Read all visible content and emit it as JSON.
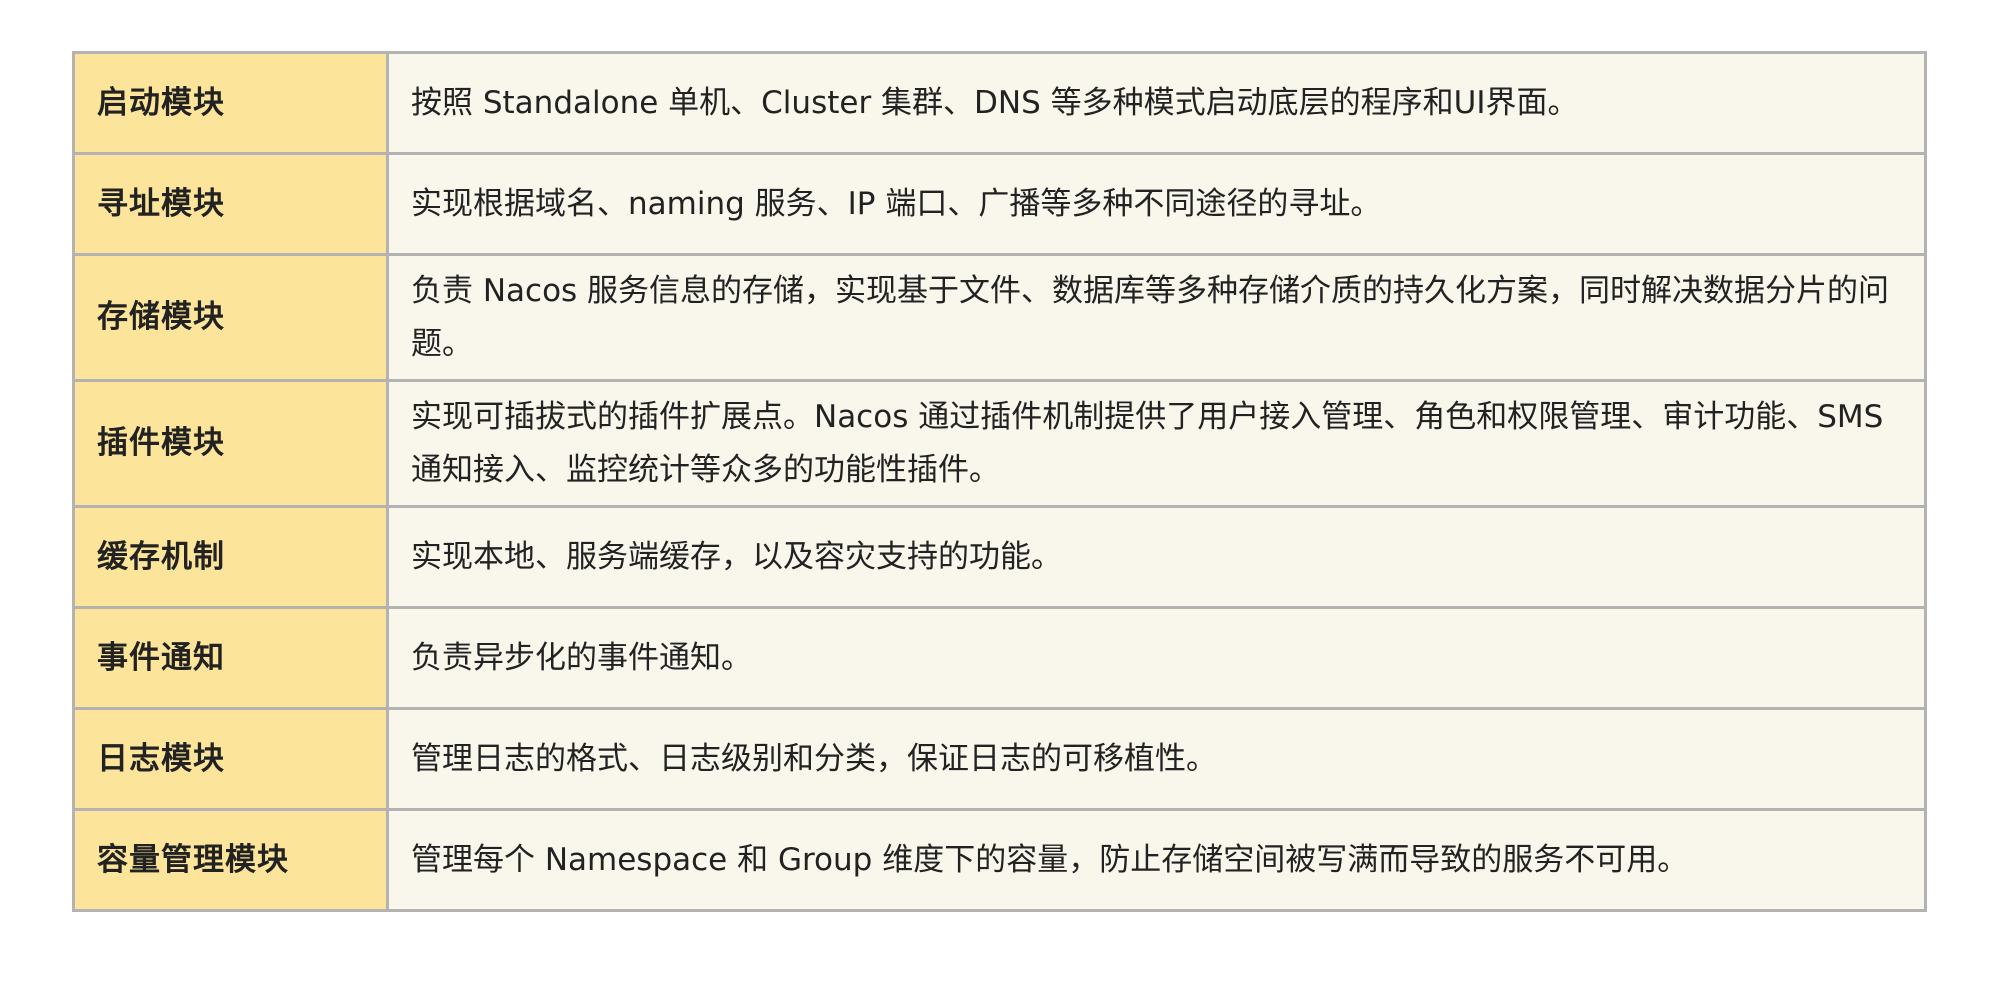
{
  "rows": [
    {
      "key": "启动模块",
      "value": "按照 Standalone 单机、Cluster 集群、DNS 等多种模式启动底层的程序和UI界面。"
    },
    {
      "key": "寻址模块",
      "value": "实现根据域名、naming 服务、IP 端口、广播等多种不同途径的寻址。"
    },
    {
      "key": "存储模块",
      "value": "负责 Nacos 服务信息的存储，实现基于文件、数据库等多种存储介质的持久化方案，同时解决数据分片的问题。"
    },
    {
      "key": "插件模块",
      "value": "实现可插拔式的插件扩展点。Nacos 通过插件机制提供了用户接入管理、角色和权限管理、审计功能、SMS 通知接入、监控统计等众多的功能性插件。"
    },
    {
      "key": "缓存机制",
      "value": "实现本地、服务端缓存，以及容灾支持的功能。"
    },
    {
      "key": "事件通知",
      "value": "负责异步化的事件通知。"
    },
    {
      "key": "日志模块",
      "value": "管理日志的格式、日志级别和分类，保证日志的可移植性。"
    },
    {
      "key": "容量管理模块",
      "value": "管理每个 Namespace 和 Group 维度下的容量，防止存储空间被写满而导致的服务不可用。"
    }
  ]
}
